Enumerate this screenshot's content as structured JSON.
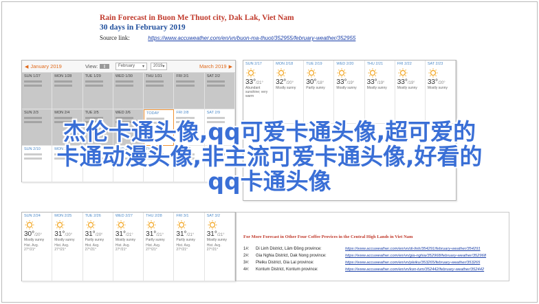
{
  "header": {
    "title": "Rain Forecast in Buon Me Thuot city, Dak Lak, Viet Nam",
    "subtitle": "30 days in February 2019",
    "source_label": "Source link:",
    "source_url": "https://www.accuweather.com/en/vn/buon-ma-thuot/352955/february-weather/352955"
  },
  "calendar": {
    "prev_month": "January 2019",
    "view_label": "View:",
    "month_select": "February",
    "year_select": "2019",
    "next_month": "March 2019"
  },
  "panel1": {
    "cells": [
      {
        "dow": "SUN 1/27",
        "state": "grey"
      },
      {
        "dow": "MON 1/28",
        "state": "grey"
      },
      {
        "dow": "TUE 1/29",
        "state": "grey"
      },
      {
        "dow": "WED 1/30",
        "state": "grey"
      },
      {
        "dow": "THU 1/31",
        "state": "grey"
      },
      {
        "dow": "FRI 2/1",
        "state": "grey"
      },
      {
        "dow": "SAT 2/2",
        "state": "grey"
      },
      {
        "dow": "SUN 2/3",
        "state": "grey"
      },
      {
        "dow": "MON 2/4",
        "state": "grey"
      },
      {
        "dow": "TUE 2/5",
        "state": "grey"
      },
      {
        "dow": "WED 2/6",
        "state": "grey"
      },
      {
        "dow": "TODAY",
        "state": "today"
      },
      {
        "dow": "FRI 2/8",
        "state": "white"
      },
      {
        "dow": "SAT 2/9",
        "state": "white"
      },
      {
        "dow": "SUN 2/10",
        "state": "white"
      },
      {
        "dow": "MON 2/11",
        "state": "white"
      },
      {
        "dow": "TUE 2/12",
        "state": "white"
      },
      {
        "dow": "WED 2/13",
        "state": "white"
      },
      {
        "dow": "THU 2/14",
        "state": "white"
      },
      {
        "dow": "FRI 2/15",
        "state": "white"
      },
      {
        "dow": "SAT 2/16",
        "state": "white"
      }
    ]
  },
  "panel2": {
    "cells": [
      {
        "dow": "SUN 2/17",
        "temp": "33°",
        "low": "/21°",
        "desc": "Abundant sunshine; very warm"
      },
      {
        "dow": "MON 2/18",
        "temp": "32°",
        "low": "/20°",
        "desc": "Mostly sunny"
      },
      {
        "dow": "TUE 2/19",
        "temp": "30°",
        "low": "/18°",
        "desc": "Partly sunny"
      },
      {
        "dow": "WED 2/20",
        "temp": "33°",
        "low": "/19°",
        "desc": "Mostly sunny"
      },
      {
        "dow": "THU 2/21",
        "temp": "33°",
        "low": "/19°",
        "desc": "Mostly sunny"
      },
      {
        "dow": "FRI 2/22",
        "temp": "33°",
        "low": "/19°",
        "desc": "Mostly sunny"
      },
      {
        "dow": "SAT 2/23",
        "temp": "33°",
        "low": "/20°",
        "desc": "Mostly sunny"
      }
    ]
  },
  "panel3": {
    "cells": [
      {
        "dow": "SUN 2/24",
        "temp": "30°",
        "low": "/20°",
        "desc": "Mostly sunny",
        "hist": "Hist. Avg. 27°/21°"
      },
      {
        "dow": "MON 2/25",
        "temp": "31°",
        "low": "/20°",
        "desc": "Mostly sunny",
        "hist": "Hist. Avg. 27°/21°"
      },
      {
        "dow": "TUE 2/26",
        "temp": "31°",
        "low": "/20°",
        "desc": "Partly sunny",
        "hist": "Hist. Avg. 27°/21°"
      },
      {
        "dow": "WED 2/27",
        "temp": "31°",
        "low": "/21°",
        "desc": "Mostly sunny",
        "hist": "Hist. Avg. 27°/21°"
      },
      {
        "dow": "THU 2/28",
        "temp": "31°",
        "low": "/21°",
        "desc": "Partly sunny",
        "hist": "Hist. Avg. 27°/21°"
      },
      {
        "dow": "FRI 3/1",
        "temp": "31°",
        "low": "/21°",
        "desc": "Partly sunny",
        "hist": "Hist. Avg. 27°/21°"
      },
      {
        "dow": "SAT 3/2",
        "temp": "31°",
        "low": "/21°",
        "desc": "Mostly sunny",
        "hist": "Hist. Avg. 27°/21°"
      }
    ]
  },
  "more": {
    "title": "For More Forecast in Other Four Coffee Provices in the Central High Lands in Viet Nam",
    "rows": [
      {
        "n": "1#:",
        "loc": "Di Linh District, Lâm Đồng province:",
        "url": "https://www.accuweather.com/en/vn/di-linh/354291/february-weather/354291"
      },
      {
        "n": "2#:",
        "loc": "Gia Nghia District, Dak Nong province:",
        "url": "https://www.accuweather.com/en/vn/gia-nghia/352968/february-weather/352968"
      },
      {
        "n": "3#:",
        "loc": "Pleiku District, Gia Lai province:",
        "url": "https://www.accuweather.com/en/vn/pleiku/353265/february-weather/353265"
      },
      {
        "n": "4#:",
        "loc": "Kontum District, Kontum province:",
        "url": "https://www.accuweather.com/en/vn/kon-tum/352442/february-weather/352442"
      }
    ]
  },
  "overlay": {
    "line1": "杰伦卡通头像,qq可爱卡通头像,超可爱的",
    "line2": "卡通动漫头像,非主流可爱卡通头像,好看的",
    "line3": "qq卡通头像"
  },
  "colors": {
    "accent": "#e06a1b",
    "title_red": "#c0392b",
    "link_blue": "#1a3fa8",
    "overlay_blue": "#3a6fd6",
    "sun": "#f2a218"
  }
}
